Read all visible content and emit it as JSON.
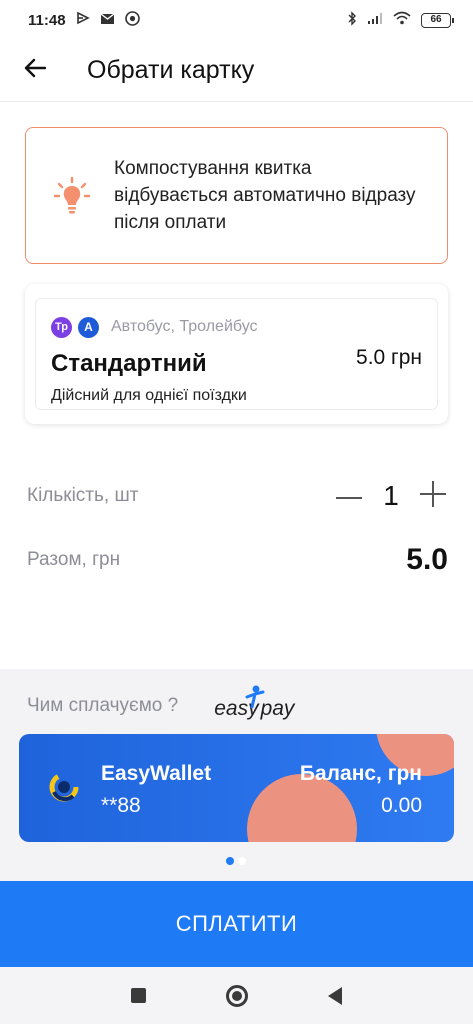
{
  "status_bar": {
    "time": "11:48",
    "battery": "66",
    "left_icons": [
      "play-icon",
      "mail-icon",
      "chrome-icon"
    ],
    "right_icons": [
      "bluetooth-icon",
      "signal-icon",
      "wifi-icon",
      "battery-icon"
    ]
  },
  "app_bar": {
    "title": "Обрати картку",
    "back_icon": "arrow-left-icon"
  },
  "info_banner": {
    "icon": "lightbulb-icon",
    "text": "Компостування квитка відбувається автоматично відразу після оплати",
    "accent_color": "#f08d6c"
  },
  "ticket": {
    "badges": [
      "Тр",
      "А"
    ],
    "transport": "Автобус, Тролейбус",
    "name": "Стандартний",
    "price": "5.0 грн",
    "description": "Дійсний для однієї поїздки"
  },
  "quantity": {
    "label": "Кількість, шт",
    "value": "1"
  },
  "total": {
    "label": "Разом, грн",
    "value": "5.0"
  },
  "payment": {
    "question": "Чим сплачуємо ?",
    "provider_logo_part1": "easy",
    "provider_logo_part2": "pay",
    "card": {
      "name": "EasyWallet",
      "number": "**88",
      "balance_label": "Баланс, грн",
      "balance": "0.00"
    },
    "pages": 2,
    "active_page": 1
  },
  "pay_button": {
    "label": "СПЛАТИТИ",
    "color": "#1e7bf5"
  }
}
